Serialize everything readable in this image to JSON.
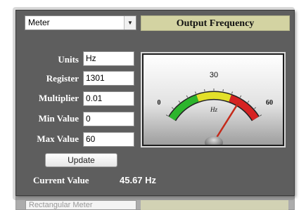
{
  "select": {
    "value": "Meter"
  },
  "title": "Output Frequency",
  "fields": [
    {
      "label": "Units",
      "value": "Hz"
    },
    {
      "label": "Register",
      "value": "1301"
    },
    {
      "label": "Multiplier",
      "value": "0.01"
    },
    {
      "label": "Min Value",
      "value": "0"
    },
    {
      "label": "Max Value",
      "value": "60"
    }
  ],
  "update_label": "Update",
  "current_value": {
    "label": "Current Value",
    "value": "45.67 Hz"
  },
  "meter": {
    "min_label": "0",
    "mid_label": "30",
    "max_label": "60",
    "unit": "Hz",
    "min": 0,
    "max": 60,
    "needle_value": 45.67,
    "zones": [
      {
        "from": 0,
        "to": 20,
        "color": "#2db52d"
      },
      {
        "from": 20,
        "to": 40,
        "color": "#e3e02a"
      },
      {
        "from": 40,
        "to": 60,
        "color": "#d62323"
      }
    ]
  },
  "below": {
    "select_value": "Rectangular Meter"
  },
  "colors": {
    "panel": "#5e5e5e",
    "title_bg": "#d3d3a2",
    "needle": "#c42a1a"
  }
}
